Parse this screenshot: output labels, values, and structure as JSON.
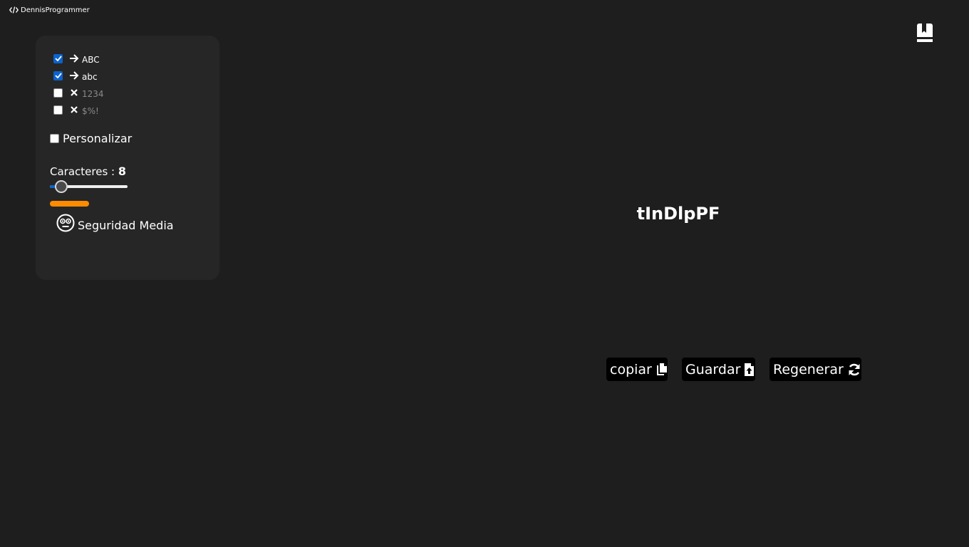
{
  "brand": {
    "name": "DennisProgrammer",
    "icon": "code-icon"
  },
  "header": {
    "bookmark_icon": "bookmark-icon"
  },
  "options": [
    {
      "label": "ABC",
      "checked": true,
      "icon": "arrow-right-icon"
    },
    {
      "label": "abc",
      "checked": true,
      "icon": "arrow-right-icon"
    },
    {
      "label": "1234",
      "checked": false,
      "icon": "x-icon"
    },
    {
      "label": "$%!",
      "checked": false,
      "icon": "x-icon"
    }
  ],
  "personalize": {
    "label": "Personalizar",
    "checked": false
  },
  "length": {
    "label": "Caracteres : ",
    "value": "8",
    "min": 8,
    "max": 64
  },
  "strength": {
    "label": "Seguridad Media",
    "icon": "face-icon",
    "color": "#ff8c00"
  },
  "password": {
    "value": "tInDlpPF"
  },
  "actions": {
    "copy_label": "copiar",
    "save_label": "Guardar",
    "regenerate_label": "Regenerar"
  },
  "colors": {
    "background": "#1e1e1e",
    "panel": "#262626",
    "accent": "#0b63ce",
    "button": "#000000"
  }
}
